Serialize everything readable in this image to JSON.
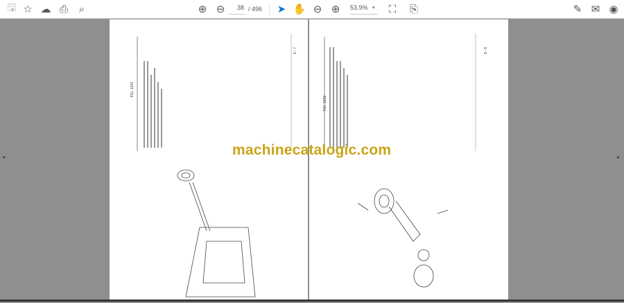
{
  "toolbar": {
    "left_icons": [
      "save-icon",
      "bookmark-star-icon",
      "upload-cloud-icon",
      "print-icon",
      "search-zoom-icon"
    ],
    "page_current": "38",
    "page_total": "/ 496",
    "zoom_value": "53.9%",
    "zoom_dropdown": "▾"
  },
  "document": {
    "watermark": "machinecatalogic.com",
    "left_page": {
      "fig_label": "FIG. 1201",
      "footer": "9 - 7"
    },
    "right_page": {
      "fig_label": "FIG. 1202",
      "footer": "9 - 8"
    }
  },
  "nav": {
    "prev_arrow": "◂",
    "next_arrow": "▸"
  },
  "colors": {
    "watermark": "#c9a416",
    "background": "#8f8f8f",
    "cursor_tool": "#1a6fd6"
  }
}
